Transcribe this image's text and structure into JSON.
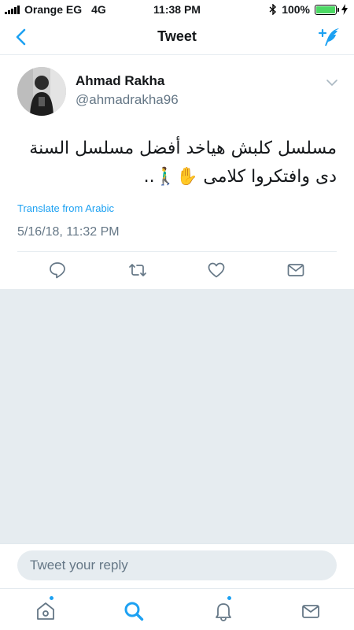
{
  "status_bar": {
    "carrier": "Orange EG",
    "network": "4G",
    "time": "11:38 PM",
    "battery": "100%",
    "battery_level": 1.0
  },
  "nav": {
    "title": "Tweet",
    "back_icon": "chevron-left-icon",
    "compose_icon": "compose-tweet-icon"
  },
  "tweet": {
    "author_name": "Ahmad Rakha",
    "author_handle": "@ahmadrakha96",
    "text": "مسلسل كلبش هياخد أفضل مسلسل السنة دى وافتكروا كلامى ✋🚶‍♂️..",
    "translate_label": "Translate from Arabic",
    "timestamp": "5/16/18, 11:32 PM",
    "actions": [
      "reply-icon",
      "retweet-icon",
      "like-icon",
      "direct-message-icon"
    ]
  },
  "reply": {
    "placeholder": "Tweet your reply"
  },
  "tabbar": {
    "tabs": [
      "home-icon",
      "search-icon",
      "notifications-icon",
      "messages-icon"
    ],
    "active": "search-icon"
  },
  "colors": {
    "accent": "#1da1f2",
    "background_gray": "#e6ecf0",
    "secondary_text": "#657786"
  }
}
